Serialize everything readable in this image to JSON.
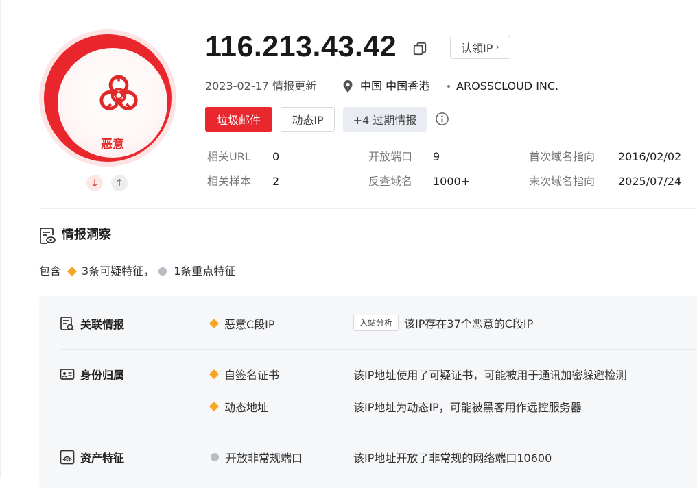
{
  "verdict": {
    "label": "恶意",
    "color": "#e8262c",
    "icon": "biohazard-icon"
  },
  "ip": "116.213.43.42",
  "claim_button": {
    "label": "认领IP",
    "icon": "chevron-right-icon"
  },
  "meta": {
    "update_date": "2023-02-17",
    "update_label": "情报更新",
    "location": "中国 中国香港",
    "location_icon": "location-pin-icon",
    "org": "AROSSCLOUD INC."
  },
  "tags": {
    "spam": "垃圾邮件",
    "dynamic_ip": "动态IP",
    "expired": "+4 过期情报",
    "spam_color": "#e8282e"
  },
  "stats": {
    "related_url": {
      "label": "相关URL",
      "value": "0"
    },
    "related_sample": {
      "label": "相关样本",
      "value": "2"
    },
    "open_ports": {
      "label": "开放端口",
      "value": "9"
    },
    "reverse_domain": {
      "label": "反查域名",
      "value": "1000+"
    },
    "first_domain": {
      "label": "首次域名指向",
      "value": "2016/02/02"
    },
    "last_domain": {
      "label": "末次域名指向",
      "value": "2025/07/24"
    }
  },
  "insight": {
    "title": "情报洞察",
    "summary_prefix": "包含",
    "summary_suspicious": "3条可疑特征，",
    "summary_key": "1条重点特征",
    "suspicious_color": "#f5a623",
    "key_color": "#b9bcc3",
    "categories": [
      {
        "name": "关联情报",
        "icon": "related-intel-icon",
        "features": [
          {
            "name": "恶意C段IP",
            "marker": "diamond",
            "tag": "入站分析",
            "desc": "该IP存在37个恶意的C段IP"
          }
        ]
      },
      {
        "name": "身份归属",
        "icon": "id-card-icon",
        "features": [
          {
            "name": "自签名证书",
            "marker": "diamond",
            "desc": "该IP地址使用了可疑证书，可能被用于通讯加密躲避检测"
          },
          {
            "name": "动态地址",
            "marker": "diamond",
            "desc": "该IP地址为动态IP，可能被黑客用作远控服务器"
          }
        ]
      },
      {
        "name": "资产特征",
        "icon": "fingerprint-icon",
        "features": [
          {
            "name": "开放非常规端口",
            "marker": "dot",
            "desc": "该IP地址开放了非常规的网络端口10600"
          }
        ]
      }
    ]
  }
}
